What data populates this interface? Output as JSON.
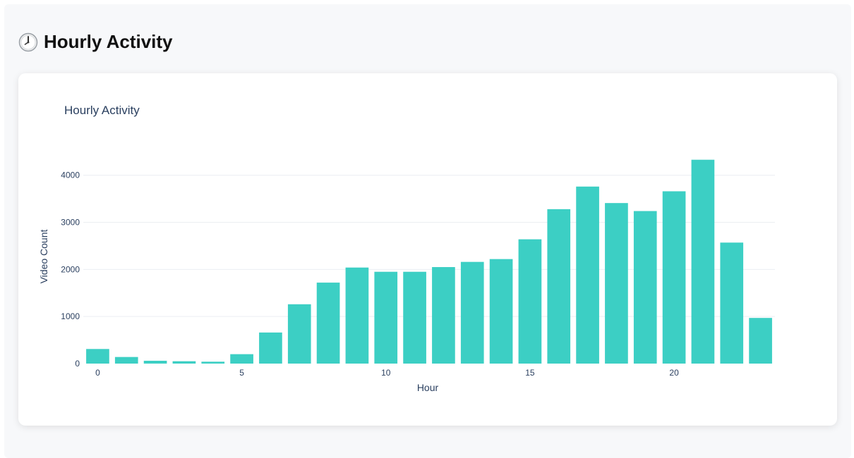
{
  "header": {
    "icon": "clock-icon",
    "title": "Hourly Activity"
  },
  "chart_data": {
    "type": "bar",
    "title": "Hourly Activity",
    "xlabel": "Hour",
    "ylabel": "Video Count",
    "x": [
      0,
      1,
      2,
      3,
      4,
      5,
      6,
      7,
      8,
      9,
      10,
      11,
      12,
      13,
      14,
      15,
      16,
      17,
      18,
      19,
      20,
      21,
      22,
      23
    ],
    "values": [
      310,
      140,
      60,
      50,
      40,
      200,
      660,
      1260,
      1720,
      2040,
      1950,
      1950,
      2050,
      2160,
      2220,
      2640,
      3280,
      3760,
      3410,
      3240,
      3660,
      4330,
      2570,
      970
    ],
    "xticks": [
      0,
      5,
      10,
      15,
      20
    ],
    "yticks": [
      0,
      1000,
      2000,
      3000,
      4000
    ],
    "ylim": [
      0,
      4550
    ],
    "bar_color": "#3ccfc4",
    "grid": true,
    "legend": "none"
  }
}
